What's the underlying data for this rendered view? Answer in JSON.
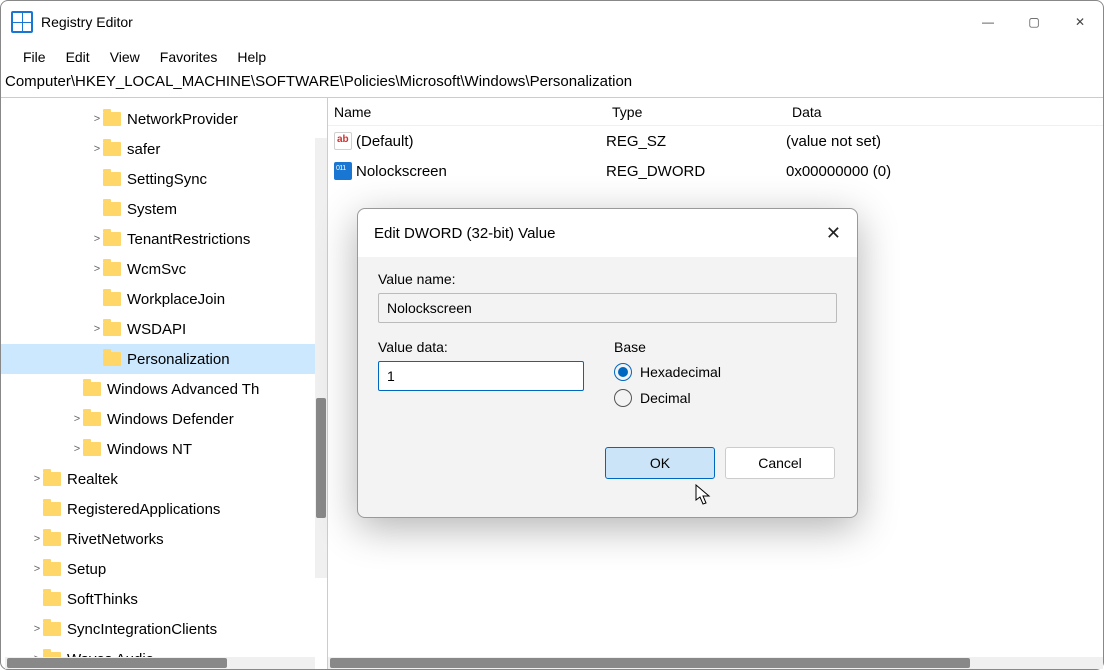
{
  "window": {
    "title": "Registry Editor"
  },
  "menu": {
    "file": "File",
    "edit": "Edit",
    "view": "View",
    "favorites": "Favorites",
    "help": "Help"
  },
  "address": "Computer\\HKEY_LOCAL_MACHINE\\SOFTWARE\\Policies\\Microsoft\\Windows\\Personalization",
  "tree": {
    "items": [
      {
        "label": "NetworkProvider",
        "indent": "ind1",
        "expander": ">"
      },
      {
        "label": "safer",
        "indent": "ind1",
        "expander": ">"
      },
      {
        "label": "SettingSync",
        "indent": "ind1",
        "expander": ""
      },
      {
        "label": "System",
        "indent": "ind1",
        "expander": ""
      },
      {
        "label": "TenantRestrictions",
        "indent": "ind1",
        "expander": ">"
      },
      {
        "label": "WcmSvc",
        "indent": "ind1",
        "expander": ">"
      },
      {
        "label": "WorkplaceJoin",
        "indent": "ind1",
        "expander": ""
      },
      {
        "label": "WSDAPI",
        "indent": "ind1",
        "expander": ">"
      },
      {
        "label": "Personalization",
        "indent": "ind1",
        "expander": "",
        "selected": true
      },
      {
        "label": "Windows Advanced Th",
        "indent": "ind2",
        "expander": ""
      },
      {
        "label": "Windows Defender",
        "indent": "ind2",
        "expander": ">"
      },
      {
        "label": "Windows NT",
        "indent": "ind2",
        "expander": ">"
      },
      {
        "label": "Realtek",
        "indent": "ind3",
        "expander": ">"
      },
      {
        "label": "RegisteredApplications",
        "indent": "ind3",
        "expander": ""
      },
      {
        "label": "RivetNetworks",
        "indent": "ind3",
        "expander": ">"
      },
      {
        "label": "Setup",
        "indent": "ind3",
        "expander": ">"
      },
      {
        "label": "SoftThinks",
        "indent": "ind3",
        "expander": ""
      },
      {
        "label": "SyncIntegrationClients",
        "indent": "ind3",
        "expander": ">"
      },
      {
        "label": "Waves Audio",
        "indent": "ind3",
        "expander": ">"
      }
    ]
  },
  "list": {
    "headers": {
      "name": "Name",
      "type": "Type",
      "data": "Data"
    },
    "rows": [
      {
        "icon": "sz",
        "name": "(Default)",
        "type": "REG_SZ",
        "data": "(value not set)"
      },
      {
        "icon": "dw",
        "name": "Nolockscreen",
        "type": "REG_DWORD",
        "data": "0x00000000 (0)"
      }
    ]
  },
  "dialog": {
    "title": "Edit DWORD (32-bit) Value",
    "value_name_label": "Value name:",
    "value_name": "Nolockscreen",
    "value_data_label": "Value data:",
    "value_data": "1",
    "base_label": "Base",
    "hex_label": "Hexadecimal",
    "dec_label": "Decimal",
    "ok": "OK",
    "cancel": "Cancel"
  }
}
